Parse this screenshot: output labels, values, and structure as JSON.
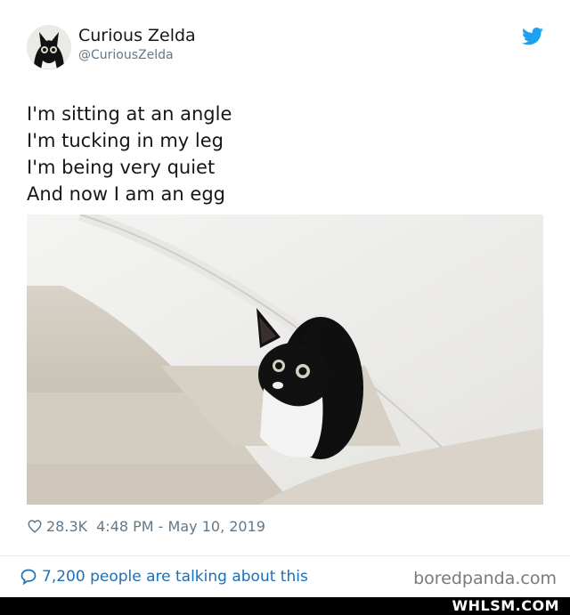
{
  "user": {
    "name": "Curious Zelda",
    "handle": "@CuriousZelda"
  },
  "icons": {
    "brand": "twitter-bird-icon",
    "likes": "heart-icon",
    "replies": "speech-bubble-icon"
  },
  "tweet": {
    "lines": [
      "I'm sitting at an angle",
      "I'm tucking in my leg",
      "I'm being very quiet",
      "And now I am an egg"
    ],
    "likes": "28.3K",
    "timestamp": "4:48 PM - May 10, 2019"
  },
  "footer": {
    "talking": "7,200 people are talking about this",
    "source": "boredpanda.com"
  },
  "watermark": "WHLSM.COM",
  "colors": {
    "twitter_blue": "#1da1f2",
    "link": "#1b6fb8",
    "muted": "#657786"
  }
}
